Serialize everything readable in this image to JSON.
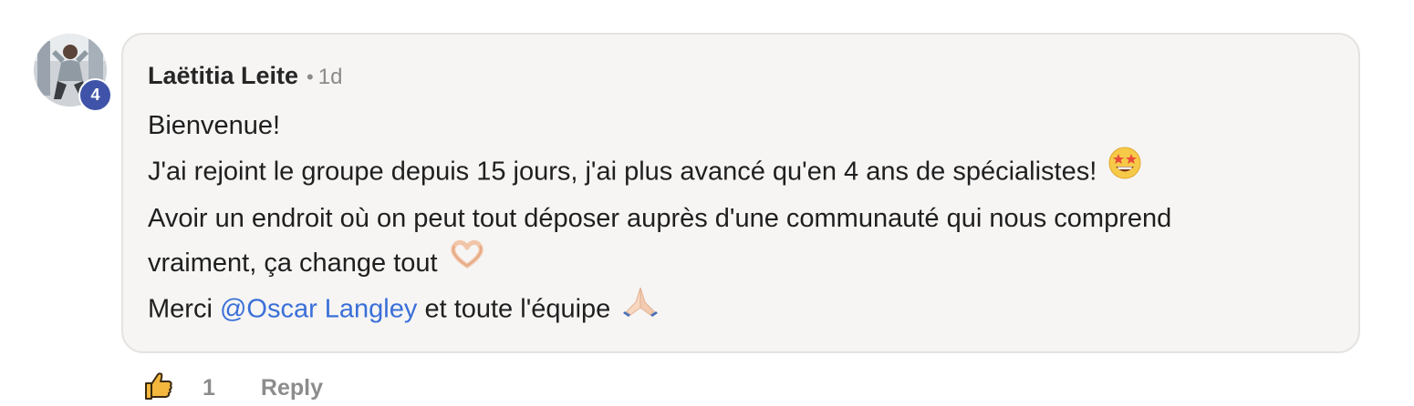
{
  "comment": {
    "author": "Laëtitia Leite",
    "separator": "•",
    "time": "1d",
    "level": "4",
    "lines": {
      "l1": "Bienvenue!",
      "l2": "J'ai rejoint le groupe depuis 15 jours, j'ai plus avancé qu'en 4 ans de spécialistes!",
      "l3": "Avoir un endroit où on peut tout déposer auprès d'une communauté qui nous comprend",
      "l4": "vraiment, ça change tout",
      "l5_before": "Merci ",
      "l5_mention": "@Oscar Langley",
      "l5_after": " et toute l'équipe"
    },
    "emojis": [
      "star-struck-emoji",
      "heart-hands-emoji",
      "folded-hands-emoji"
    ]
  },
  "actions": {
    "like_icon": "thumbs-up-icon",
    "like_count": "1",
    "reply_label": "Reply"
  },
  "colors": {
    "mention": "#3a6fd8",
    "badge": "#3f54a8",
    "bubble_bg": "#f6f5f4",
    "muted_text": "#8c8c8c"
  }
}
